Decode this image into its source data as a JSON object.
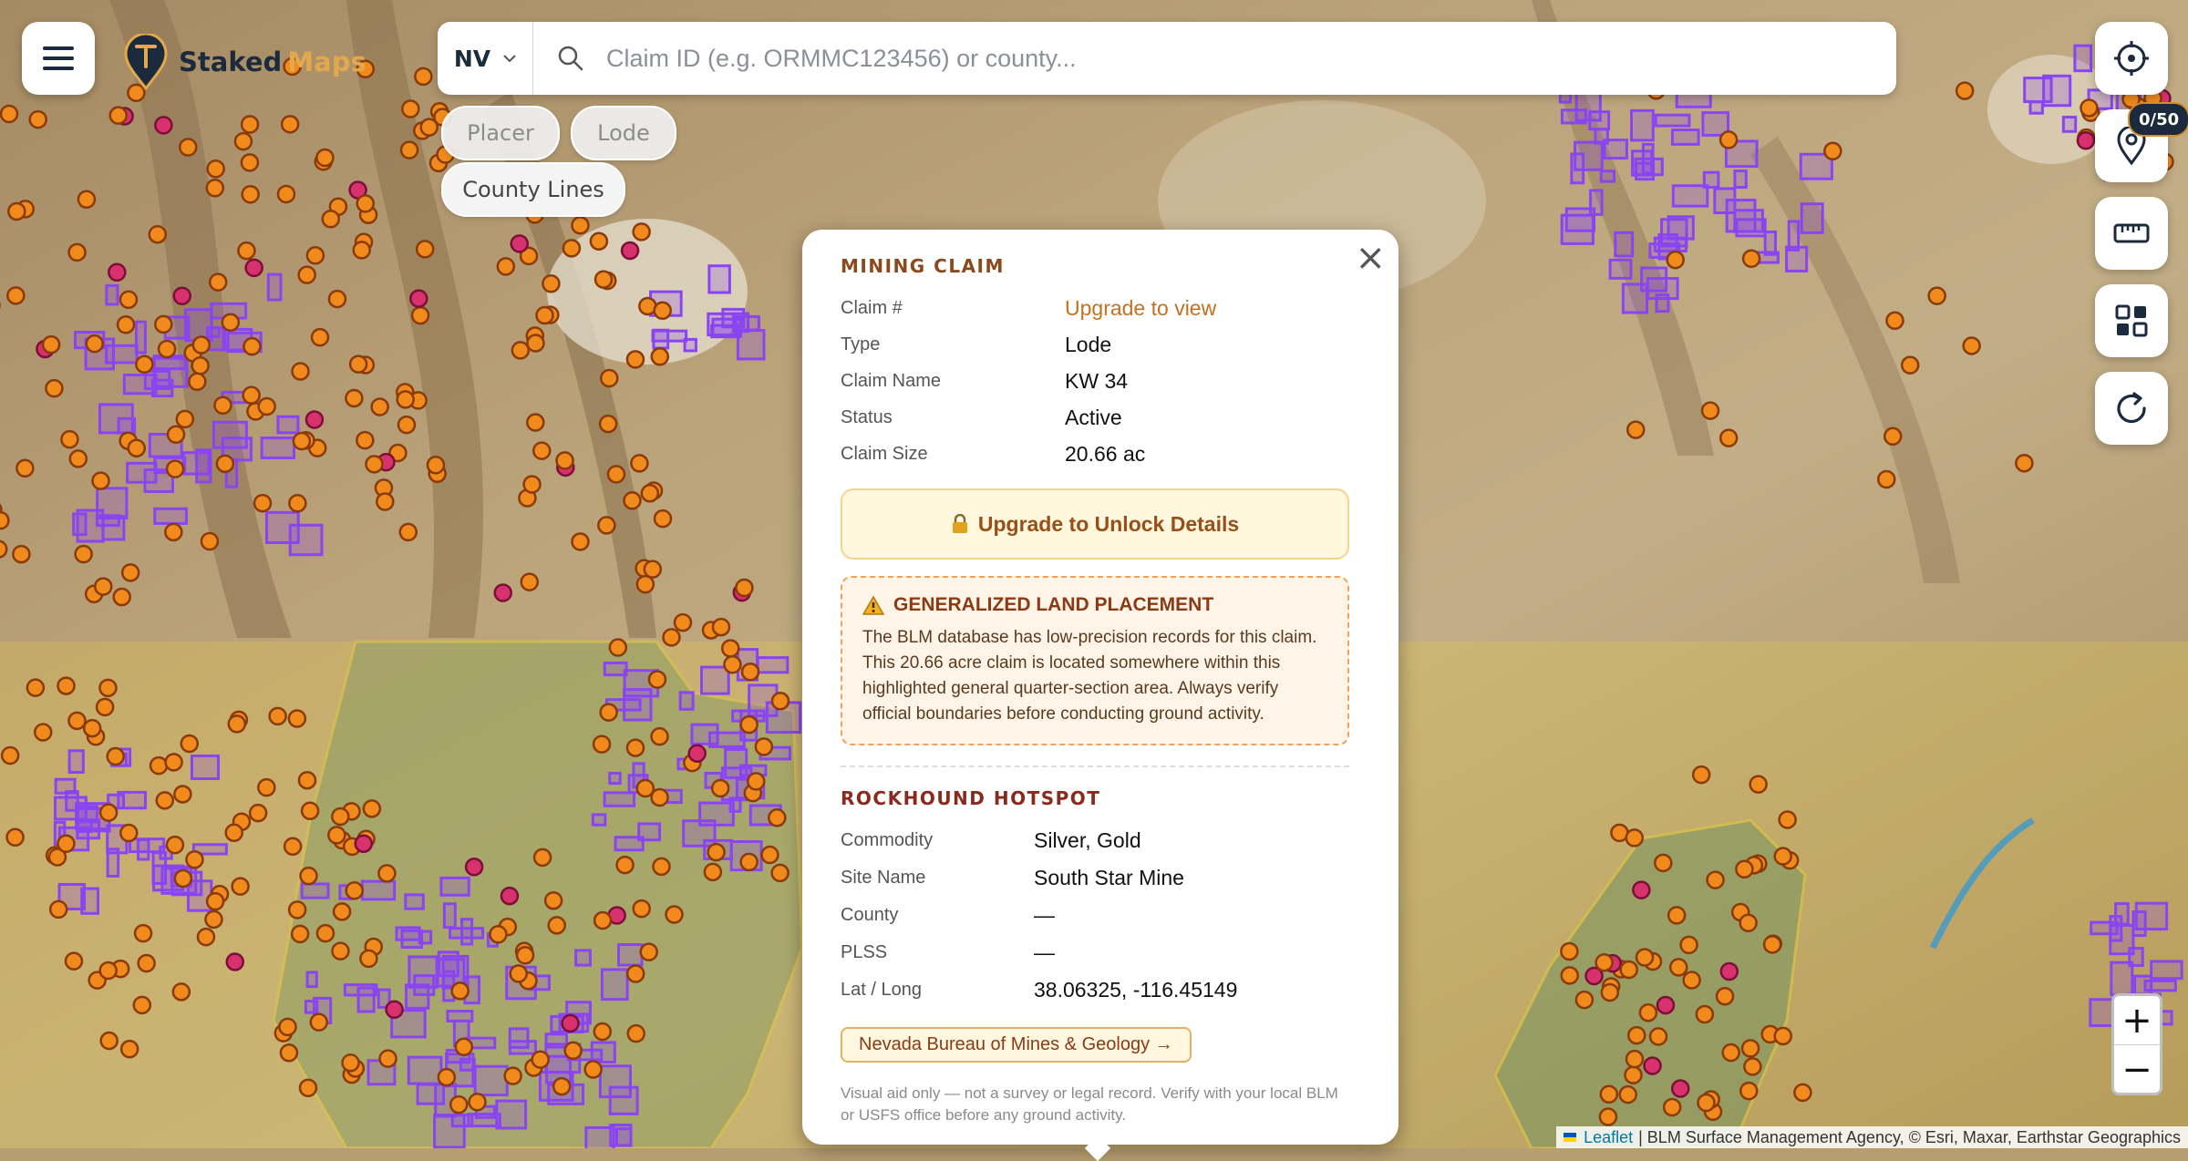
{
  "app": {
    "brand_part1": "Staked",
    "brand_part2": "Maps"
  },
  "search": {
    "state_value": "NV",
    "placeholder": "Claim ID (e.g. ORMMC123456) or county..."
  },
  "filters": [
    {
      "label": "Placer",
      "active": false
    },
    {
      "label": "Lode",
      "active": false
    },
    {
      "label": "County Lines",
      "active": true
    }
  ],
  "right_toolbar": {
    "pin_counter": "0/50",
    "buttons": [
      "locate-icon",
      "pin-icon",
      "ruler-icon",
      "grid-icon",
      "refresh-icon"
    ]
  },
  "popup": {
    "claim_title": "MINING CLAIM",
    "claim_fields": [
      {
        "label": "Claim #",
        "value": "Upgrade to view"
      },
      {
        "label": "Type",
        "value": "Lode"
      },
      {
        "label": "Claim Name",
        "value": "KW 34"
      },
      {
        "label": "Status",
        "value": "Active"
      },
      {
        "label": "Claim Size",
        "value": "20.66 ac"
      }
    ],
    "unlock_label": "Upgrade to Unlock Details",
    "warning_title": "GENERALIZED LAND PLACEMENT",
    "warning_text": "The BLM database has low-precision records for this claim. This 20.66 acre claim is located somewhere within this highlighted general quarter-section area. Always verify official boundaries before conducting ground activity.",
    "rock_title": "ROCKHOUND HOTSPOT",
    "rock_fields": [
      {
        "label": "Commodity",
        "value": "Silver, Gold"
      },
      {
        "label": "Site Name",
        "value": "South Star Mine"
      },
      {
        "label": "County",
        "value": "—"
      },
      {
        "label": "PLSS",
        "value": "—"
      },
      {
        "label": "Lat / Long",
        "value": "38.06325, -116.45149"
      }
    ],
    "link_label": "Nevada Bureau of Mines & Geology →",
    "disclaimer": "Visual aid only — not a survey or legal record. Verify with your local BLM or USFS office before any ground activity."
  },
  "zoom": {
    "in": "+",
    "out": "−"
  },
  "attribution": {
    "leaflet": "Leaflet",
    "text": "| BLM Surface Management Agency, © Esri, Maxar, Earthstar Geographics"
  },
  "colors": {
    "claim_marker": "#f08a1c",
    "hotspot_marker": "#d8326e",
    "claim_polygon": "#8a45f0",
    "land_overlay": "#f2d24a"
  }
}
